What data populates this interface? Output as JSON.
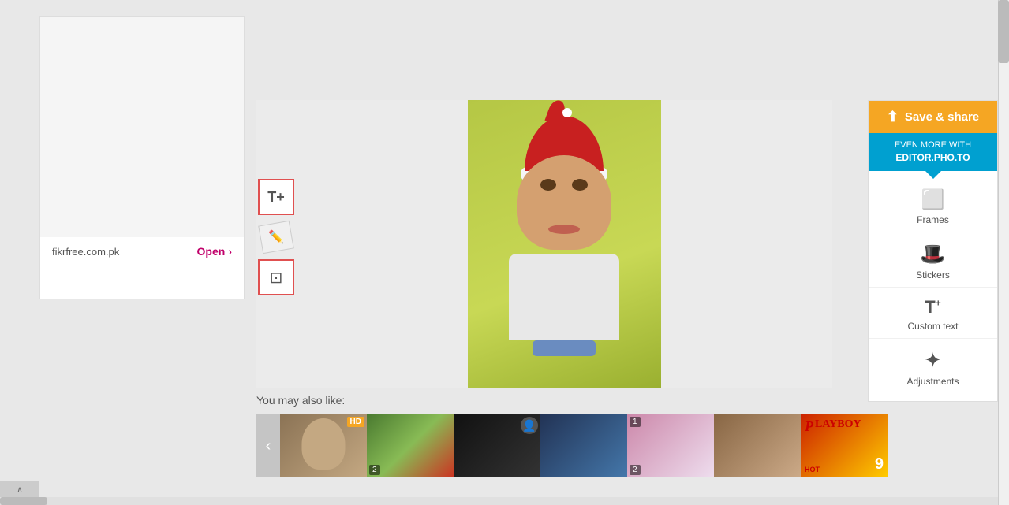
{
  "left_panel": {
    "url": "fikrfree.com.pk",
    "open_label": "Open",
    "chevron": "›"
  },
  "toolbar": {
    "text_tool_icon": "T+",
    "eraser_icon": "✏",
    "crop_tool_icon": "⊡"
  },
  "right_sidebar": {
    "save_label": "Save & share",
    "share_icon": "share",
    "promo_line1": "EVEN MORE WITH",
    "promo_line2": "EDITOR.PHO.TO",
    "frames_label": "Frames",
    "stickers_label": "Stickers",
    "custom_text_label": "Custom text",
    "adjustments_label": "Adjustments"
  },
  "bottom": {
    "you_may_like": "You may also like:",
    "nav_prev": "‹",
    "thumbnails": [
      {
        "id": 1,
        "badge": "HD",
        "badge_type": "hd",
        "num": ""
      },
      {
        "id": 2,
        "badge": "",
        "badge_type": "",
        "num": "2"
      },
      {
        "id": 3,
        "badge": "person",
        "badge_type": "icon",
        "num": ""
      },
      {
        "id": 4,
        "badge": "",
        "badge_type": "",
        "num": ""
      },
      {
        "id": 5,
        "badge": "",
        "badge_type": "",
        "num": "2"
      },
      {
        "id": 6,
        "badge": "",
        "badge_type": "",
        "num": ""
      },
      {
        "id": 7,
        "badge": "",
        "badge_type": "",
        "num": ""
      }
    ]
  }
}
